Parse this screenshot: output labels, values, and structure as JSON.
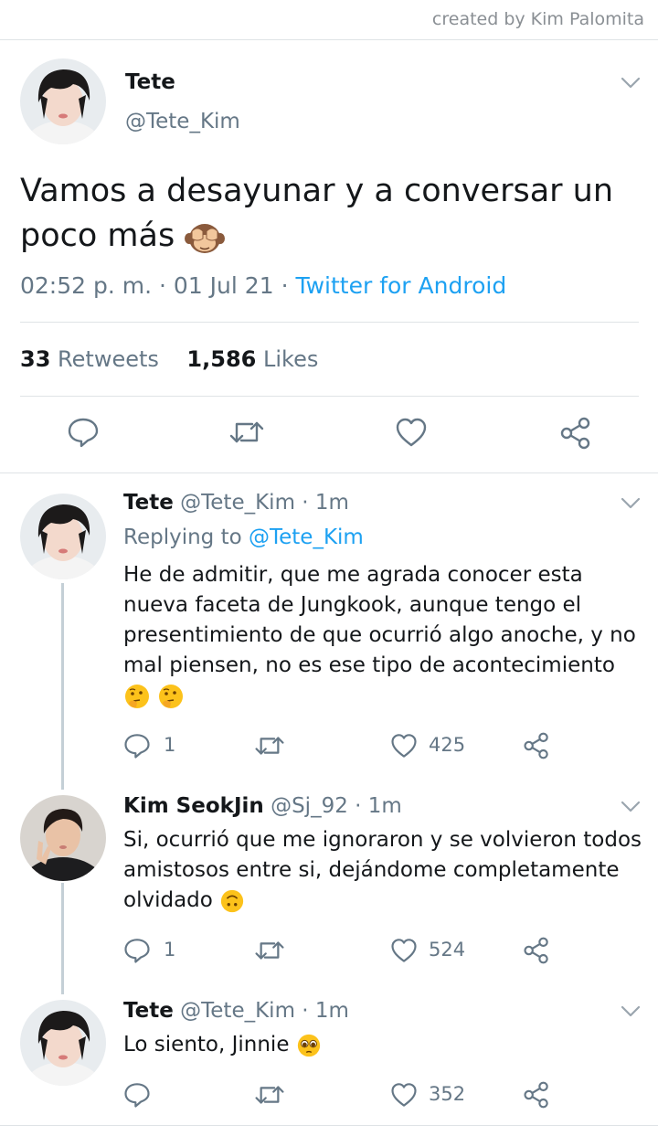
{
  "credit": "created by Kim Palomita",
  "main_tweet": {
    "name": "Tete",
    "handle": "@Tete_Kim",
    "text": "Vamos a desayunar y a conversar un poco más",
    "time": "02:52 p. m.",
    "date": "01 Jul 21",
    "source": "Twitter for Android",
    "retweets": "33",
    "retweets_label": "Retweets",
    "likes": "1,586",
    "likes_label": "Likes"
  },
  "replies": [
    {
      "name": "Tete",
      "handle": "@Tete_Kim",
      "time": "1m",
      "replying_to_label": "Replying to",
      "replying_to": "@Tete_Kim",
      "text": "He de admitir, que me agrada conocer esta nueva faceta de Jungkook, aunque tengo el presentimiento de que ocurrió algo anoche, y no mal piensen, no es ese tipo de acontecimiento",
      "replies": "1",
      "likes": "425"
    },
    {
      "name": "Kim SeokJin",
      "handle": "@Sj_92",
      "time": "1m",
      "text": "Si, ocurrió que me ignoraron y se volvieron todos amistosos entre si, dejándome completamente olvidado",
      "replies": "1",
      "likes": "524"
    },
    {
      "name": "Tete",
      "handle": "@Tete_Kim",
      "time": "1m",
      "text": "Lo siento, Jinnie",
      "likes": "352"
    }
  ],
  "icons": [
    "reply-icon",
    "retweet-icon",
    "like-icon",
    "share-icon",
    "chevron-down-icon"
  ],
  "colors": {
    "accent": "#1da1f2",
    "secondary_text": "#657786",
    "separator": "#dfe3e6"
  }
}
